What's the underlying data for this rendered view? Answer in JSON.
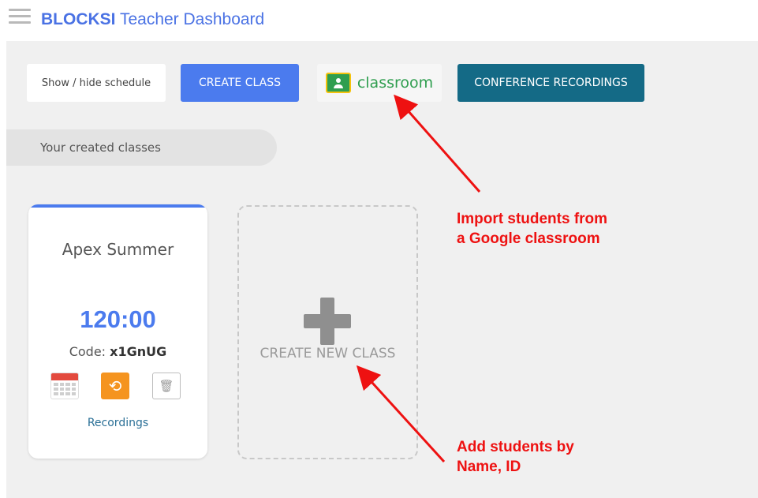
{
  "header": {
    "brand": "BLOCKSI",
    "title": " Teacher Dashboard"
  },
  "toolbar": {
    "show_hide_label": "Show / hide schedule",
    "create_class_label": "CREATE CLASS",
    "classroom_label": "classroom",
    "conference_label": "CONFERENCE RECORDINGS"
  },
  "section": {
    "label": "Your created classes"
  },
  "class_card": {
    "name": "Apex Summer",
    "timer": "120:00",
    "code_prefix": "Code: ",
    "code": "x1GnUG",
    "recordings_label": "Recordings"
  },
  "new_class": {
    "label": "CREATE NEW CLASS"
  },
  "annotations": [
    {
      "lines": [
        "Import students from",
        "a Google classroom"
      ]
    },
    {
      "lines": [
        "Add students by",
        "Name, ID"
      ]
    }
  ],
  "colors": {
    "brand_blue": "#4a72e4",
    "primary_button": "#4b7bee",
    "conference_button": "#146a86",
    "annotation_red": "#ee1111",
    "reset_orange": "#f5941f",
    "classroom_green": "#2f9e4f"
  },
  "icons": {
    "menu": "hamburger-icon",
    "calendar": "calendar-icon",
    "reset": "reset-icon",
    "delete": "trash-icon",
    "add": "plus-icon",
    "classroom_logo": "google-classroom-icon"
  }
}
